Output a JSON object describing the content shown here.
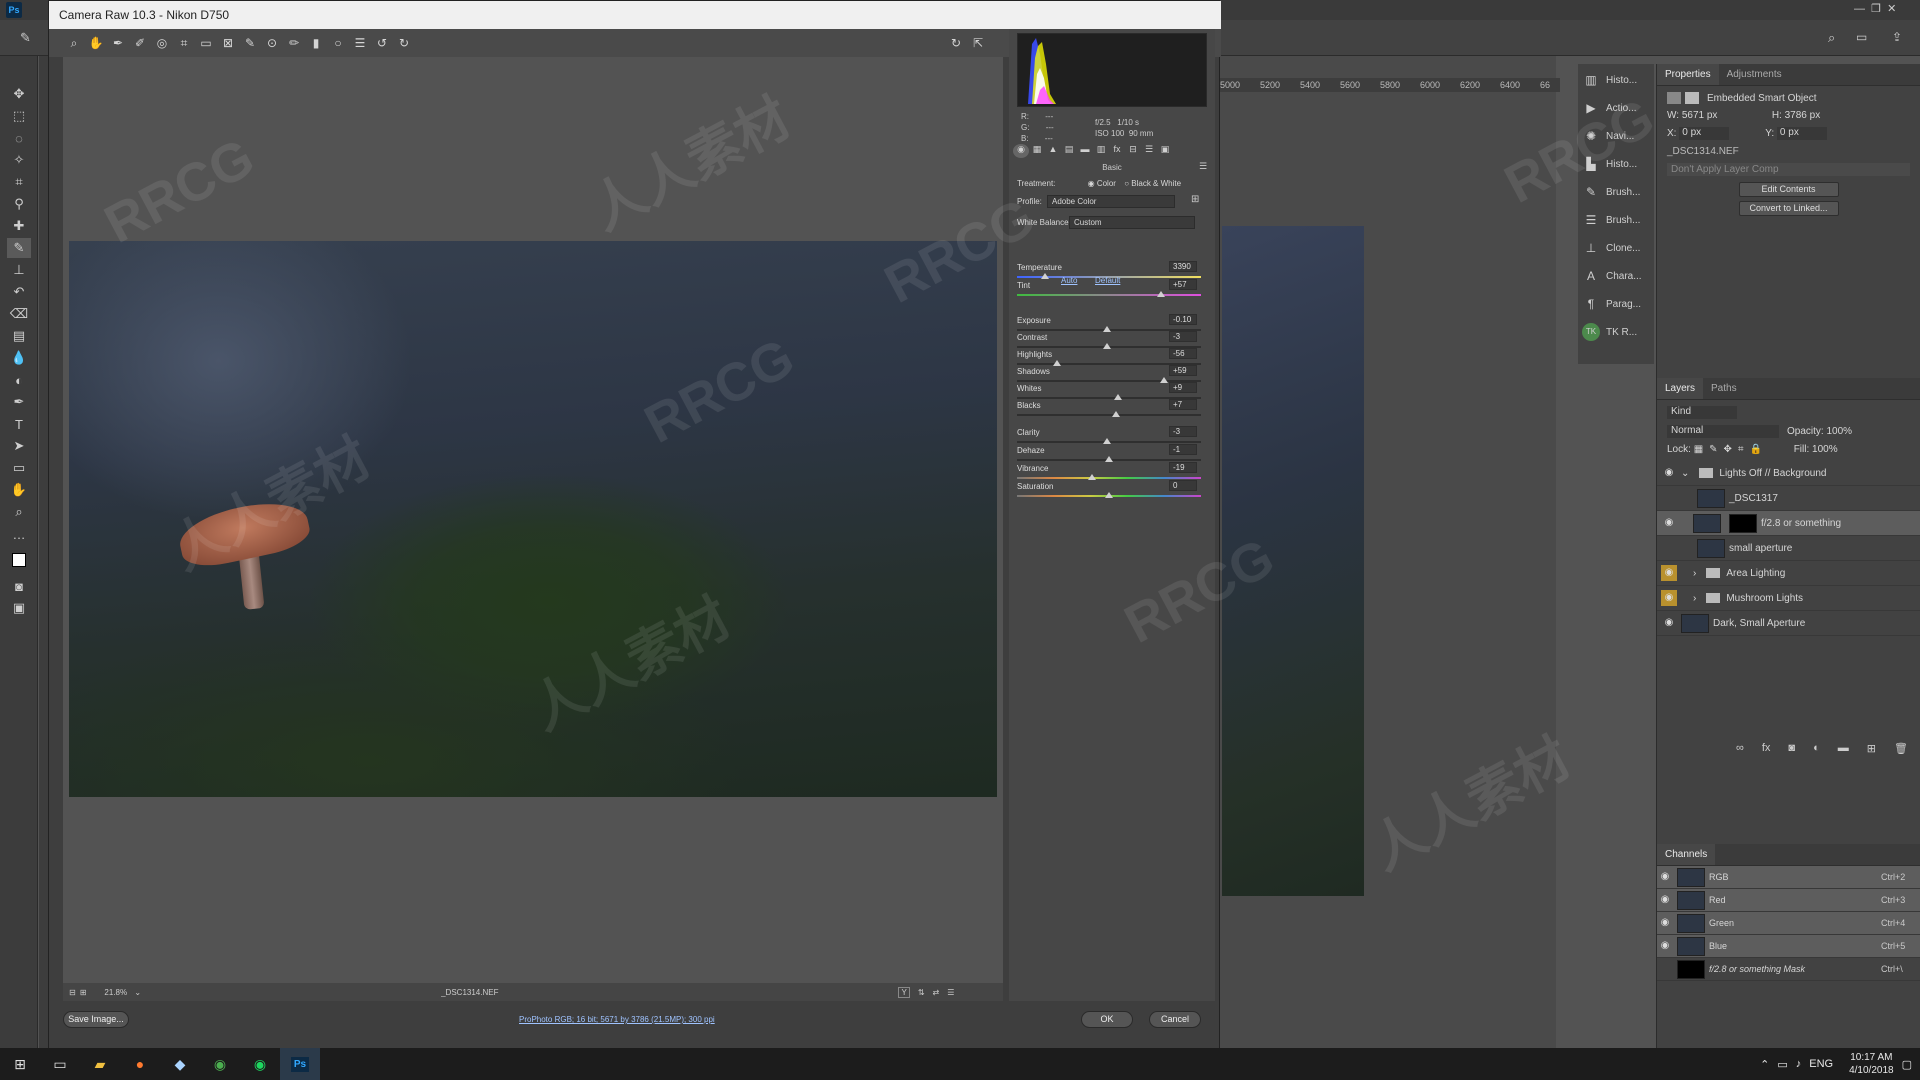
{
  "acr": {
    "title": "Camera Raw 10.3  -  Nikon D750",
    "histogram": {
      "r_label": "R:",
      "g_label": "G:",
      "b_label": "B:",
      "r_value": "---",
      "g_value": "---",
      "b_value": "---",
      "aperture": "f/2.5",
      "shutter": "1/10 s",
      "iso": "ISO 100",
      "focal": "90 mm"
    },
    "panel_title": "Basic",
    "treatment_label": "Treatment:",
    "treatment_options": [
      "Color",
      "Black & White"
    ],
    "profile_label": "Profile:",
    "profile_value": "Adobe Color",
    "wb_label": "White Balance:",
    "wb_value": "Custom",
    "auto_label": "Auto",
    "default_label": "Default",
    "sliders": [
      {
        "label": "Temperature",
        "value": "3390",
        "position": 0.15
      },
      {
        "label": "Tint",
        "value": "+57",
        "position": 0.78
      },
      {
        "label": "Exposure",
        "value": "-0.10",
        "position": 0.49
      },
      {
        "label": "Contrast",
        "value": "-3",
        "position": 0.49
      },
      {
        "label": "Highlights",
        "value": "-56",
        "position": 0.22
      },
      {
        "label": "Shadows",
        "value": "+59",
        "position": 0.8
      },
      {
        "label": "Whites",
        "value": "+9",
        "position": 0.55
      },
      {
        "label": "Blacks",
        "value": "+7",
        "position": 0.54
      },
      {
        "label": "Clarity",
        "value": "-3",
        "position": 0.49
      },
      {
        "label": "Dehaze",
        "value": "-1",
        "position": 0.5
      },
      {
        "label": "Vibrance",
        "value": "-19",
        "position": 0.41
      },
      {
        "label": "Saturation",
        "value": "0",
        "position": 0.5
      }
    ],
    "zoom": "21.8%",
    "filename": "_DSC1314.NEF",
    "save_label": "Save Image...",
    "workflow_link": "ProPhoto RGB; 16 bit; 5671 by 3786 (21.5MP); 300 ppi",
    "ok_label": "OK",
    "cancel_label": "Cancel"
  },
  "ps": {
    "ruler_ticks": [
      "5000",
      "5200",
      "5400",
      "5600",
      "5800",
      "6000",
      "6200",
      "6400",
      "66"
    ],
    "icon_panel": [
      {
        "label": "Histo...",
        "icon": "histogram-icon"
      },
      {
        "label": "Actio...",
        "icon": "play-icon"
      },
      {
        "label": "Navi...",
        "icon": "navigator-icon"
      },
      {
        "label": "Histo...",
        "icon": "history-icon"
      },
      {
        "label": "Brush...",
        "icon": "brush-icon"
      },
      {
        "label": "Brush...",
        "icon": "brush-settings-icon"
      },
      {
        "label": "Clone...",
        "icon": "clone-icon"
      },
      {
        "label": "Chara...",
        "icon": "character-icon"
      },
      {
        "label": "Parag...",
        "icon": "paragraph-icon"
      },
      {
        "label": "TK R...",
        "icon": "tk-icon"
      }
    ],
    "properties": {
      "tabs": [
        "Properties",
        "Adjustments"
      ],
      "type": "Embedded Smart Object",
      "w_label": "W:",
      "w_value": "5671 px",
      "h_label": "H:",
      "h_value": "3786 px",
      "x_label": "X:",
      "x_value": "0 px",
      "y_label": "Y:",
      "y_value": "0 px",
      "file": "_DSC1314.NEF",
      "layer_comp": "Don't Apply Layer Comp",
      "edit_contents": "Edit Contents",
      "convert": "Convert to Linked..."
    },
    "layers": {
      "tabs": [
        "Layers",
        "Paths"
      ],
      "kind": "Kind",
      "blend": "Normal",
      "opacity_label": "Opacity:",
      "opacity_value": "100%",
      "lock_label": "Lock:",
      "fill_label": "Fill:",
      "fill_value": "100%",
      "items": [
        {
          "name": "Lights Off // Background"
        },
        {
          "name": "_DSC1317"
        },
        {
          "name": "f/2.8 or something"
        },
        {
          "name": "small aperture"
        },
        {
          "name": "Area Lighting"
        },
        {
          "name": "Mushroom Lights"
        },
        {
          "name": "Dark, Small Aperture"
        }
      ]
    },
    "channels": {
      "title": "Channels",
      "items": [
        {
          "name": "RGB",
          "key": "Ctrl+2"
        },
        {
          "name": "Red",
          "key": "Ctrl+3"
        },
        {
          "name": "Green",
          "key": "Ctrl+4"
        },
        {
          "name": "Blue",
          "key": "Ctrl+5"
        },
        {
          "name": "f/2.8 or something Mask",
          "key": "Ctrl+\\"
        }
      ]
    }
  },
  "taskbar": {
    "lang": "ENG",
    "time": "10:17 AM",
    "date": "4/10/2018"
  },
  "watermark": {
    "text_a": "RRCG",
    "text_b": "人人素材"
  },
  "colors": {
    "accent_yellow": "#b9912e",
    "dialog_bg": "#3e3e3e",
    "ps_bg": "#535353"
  }
}
